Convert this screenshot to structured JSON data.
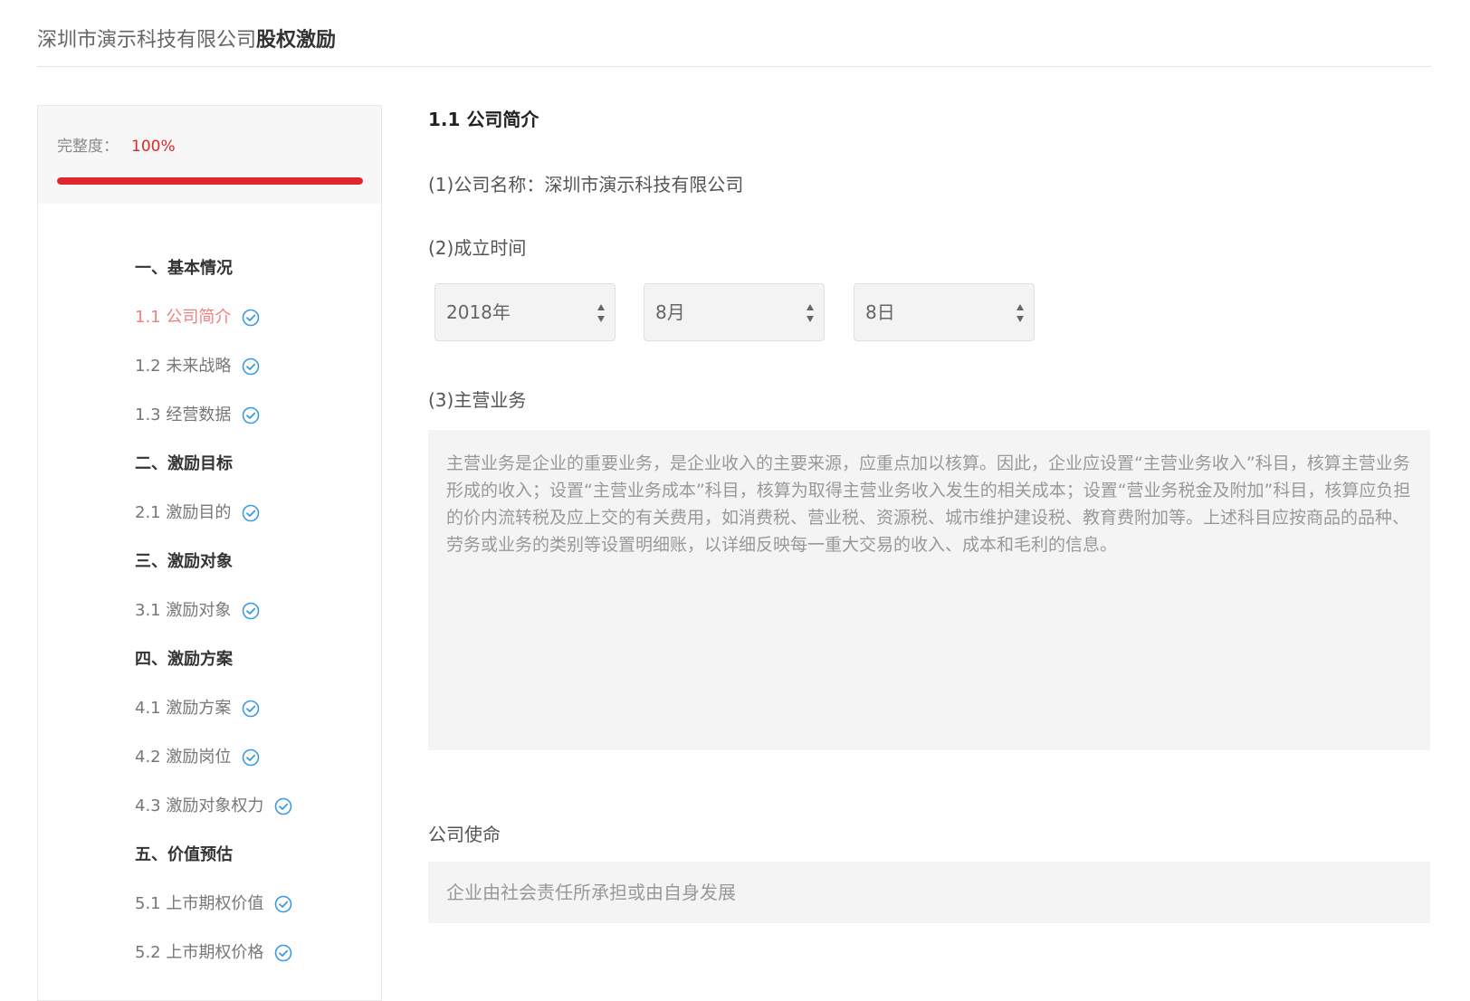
{
  "header": {
    "company": "深圳市演示科技有限公司",
    "module": "股权激励"
  },
  "sidebar": {
    "completeness_label": "完整度：",
    "completeness_value": "100%",
    "completeness_fraction": 1.0,
    "accent_color": "#e0262b",
    "items": [
      {
        "label": "一、基本情况",
        "kind": "section"
      },
      {
        "label": "1.1 公司简介",
        "kind": "sub",
        "active": true,
        "icon": "check-circle-icon"
      },
      {
        "label": "1.2 未来战略",
        "kind": "sub",
        "icon": "check-circle-icon"
      },
      {
        "label": "1.3 经营数据",
        "kind": "sub",
        "icon": "check-circle-icon"
      },
      {
        "label": "二、激励目标",
        "kind": "section"
      },
      {
        "label": "2.1 激励目的",
        "kind": "sub",
        "icon": "check-circle-icon"
      },
      {
        "label": "三、激励对象",
        "kind": "section"
      },
      {
        "label": "3.1 激励对象",
        "kind": "sub",
        "icon": "check-circle-icon"
      },
      {
        "label": "四、激励方案",
        "kind": "section"
      },
      {
        "label": "4.1 激励方案",
        "kind": "sub",
        "icon": "check-circle-icon"
      },
      {
        "label": "4.2 激励岗位",
        "kind": "sub",
        "icon": "check-circle-icon"
      },
      {
        "label": "4.3 激励对象权力",
        "kind": "sub",
        "icon": "check-circle-icon"
      },
      {
        "label": "五、价值预估",
        "kind": "section"
      },
      {
        "label": "5.1 上市期权价值",
        "kind": "sub",
        "icon": "check-circle-icon"
      },
      {
        "label": "5.2 上市期权价格",
        "kind": "sub",
        "icon": "check-circle-icon"
      }
    ]
  },
  "main": {
    "title": "1.1 公司简介",
    "company_name_label": "(1)公司名称：深圳市演示科技有限公司",
    "founded_label": "(2)成立时间",
    "year": "2018年",
    "month": "8月",
    "day": "8日",
    "business_label": "(3)主营业务",
    "business_text": "主营业务是企业的重要业务，是企业收入的主要来源，应重点加以核算。因此，企业应设置“主营业务收入”科目，核算主营业务形成的收入；设置“主营业务成本”科目，核算为取得主营业务收入发生的相关成本；设置“营业务税金及附加”科目，核算应负担的价内流转税及应上交的有关费用，如消费税、营业税、资源税、城市维护建设税、教育费附加等。上述科目应按商品的品种、劳务或业务的类别等设置明细账，以详细反映每一重大交易的收入、成本和毛利的信息。",
    "mission_label": "公司使命",
    "mission_value": "企业由社会责任所承担或由自身发展"
  }
}
